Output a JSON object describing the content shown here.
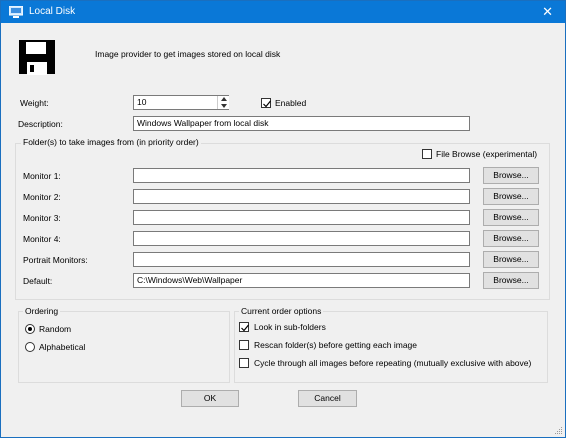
{
  "window": {
    "title": "Local Disk",
    "close_glyph": "✕"
  },
  "header": {
    "icon": "floppy-disk-icon",
    "description": "Image provider to get images stored on local disk"
  },
  "weight": {
    "label": "Weight:",
    "value": "10",
    "enabled_label": "Enabled",
    "enabled_checked": true
  },
  "description": {
    "label": "Description:",
    "value": "Windows Wallpaper from local disk"
  },
  "folders": {
    "group_title": "Folder(s) to take images from (in priority order)",
    "file_browse_label": "File Browse (experimental)",
    "file_browse_checked": false,
    "browse_label": "Browse...",
    "rows": [
      {
        "label": "Monitor 1:",
        "value": ""
      },
      {
        "label": "Monitor 2:",
        "value": ""
      },
      {
        "label": "Monitor 3:",
        "value": ""
      },
      {
        "label": "Monitor 4:",
        "value": ""
      },
      {
        "label": "Portrait Monitors:",
        "value": ""
      },
      {
        "label": "Default:",
        "value": "C:\\Windows\\Web\\Wallpaper"
      }
    ]
  },
  "ordering": {
    "group_title": "Ordering",
    "options": [
      {
        "label": "Random",
        "selected": true
      },
      {
        "label": "Alphabetical",
        "selected": false
      }
    ]
  },
  "order_options": {
    "group_title": "Current order options",
    "options": [
      {
        "label": "Look in sub-folders",
        "checked": true
      },
      {
        "label": "Rescan folder(s) before getting each image",
        "checked": false
      },
      {
        "label": "Cycle through all images before repeating (mutually exclusive with above)",
        "checked": false
      }
    ]
  },
  "buttons": {
    "ok": "OK",
    "cancel": "Cancel"
  },
  "colors": {
    "titlebar": "#0a78d7",
    "dialog_bg": "#f0f0f0"
  }
}
